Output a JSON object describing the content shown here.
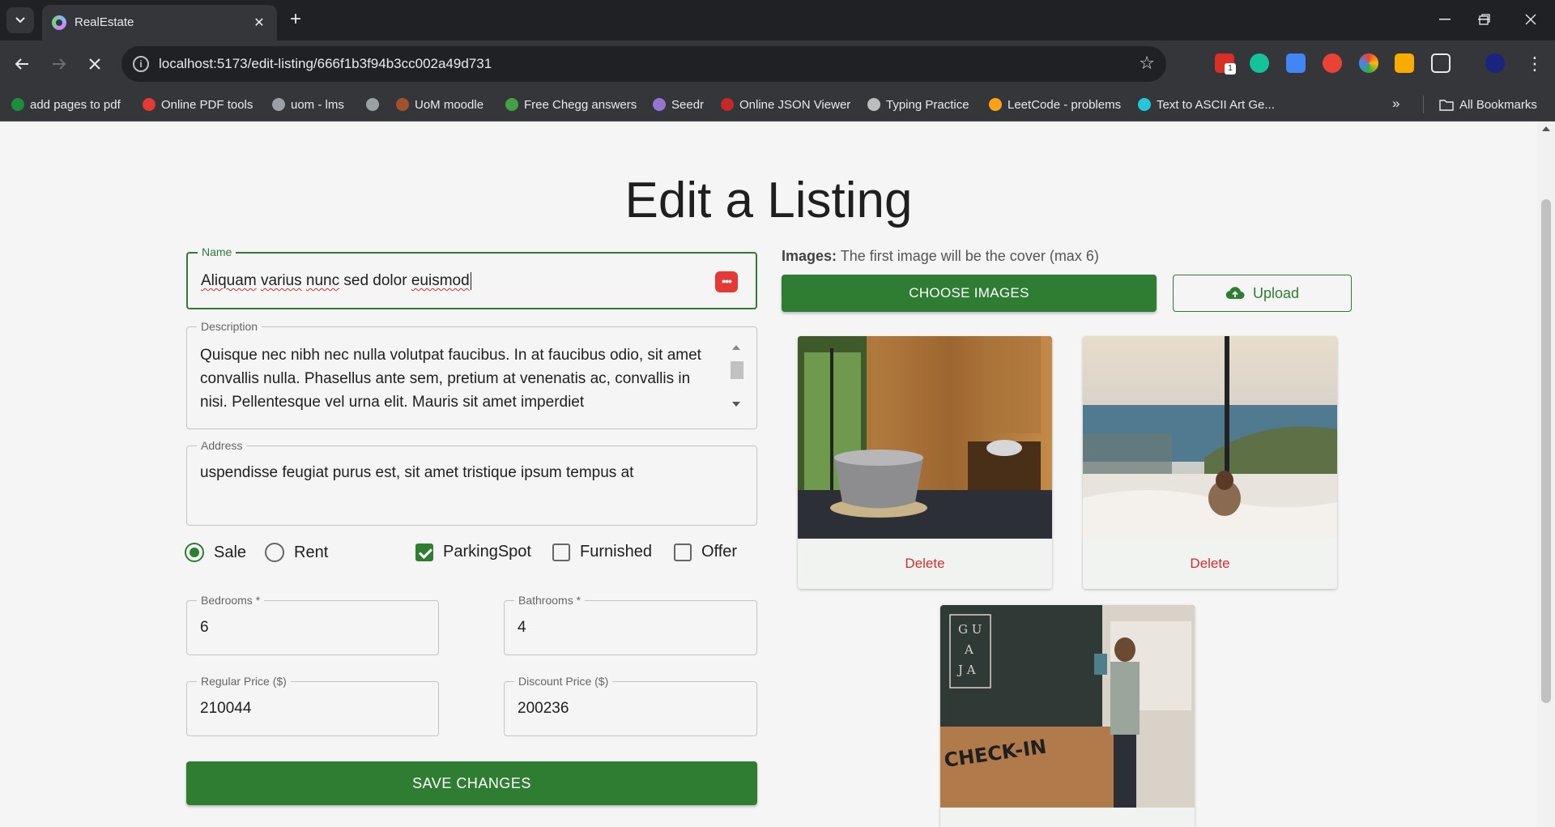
{
  "browser": {
    "tab_title": "RealEstate",
    "url": "localhost:5173/edit-listing/666f1b3f94b3cc002a49d731",
    "bookmarks": [
      {
        "label": "add pages to pdf",
        "color": "#1e8e3e"
      },
      {
        "label": "Online PDF tools",
        "color": "#e53935"
      },
      {
        "label": "uom - lms",
        "color": "#9aa0a6"
      },
      {
        "label": "",
        "color": "#9aa0a6"
      },
      {
        "label": "UoM moodle",
        "color": "#a0522d"
      },
      {
        "label": "Free Chegg answers",
        "color": "#43a047"
      },
      {
        "label": "Seedr",
        "color": "#9575cd"
      },
      {
        "label": "Online JSON Viewer",
        "color": "#c62828"
      },
      {
        "label": "Typing Practice",
        "color": "#bdbdbd"
      },
      {
        "label": "LeetCode - problems",
        "color": "#ffa116"
      },
      {
        "label": "Text to ASCII Art Ge...",
        "color": "#26c6da"
      }
    ],
    "all_bookmarks": "All Bookmarks",
    "extension_badge": "1"
  },
  "page": {
    "title": "Edit a Listing",
    "form": {
      "name": {
        "label": "Name",
        "value_parts": [
          "Aliquam",
          "varius",
          "nunc",
          "sed dolor",
          "euismod"
        ]
      },
      "description": {
        "label": "Description",
        "value": "Quisque nec nibh nec nulla volutpat faucibus. In at faucibus odio, sit amet convallis nulla. Phasellus ante sem, pretium at venenatis ac, convallis in nisi. Pellentesque vel urna elit. Mauris sit amet imperdiet"
      },
      "address": {
        "label": "Address",
        "value": "uspendisse feugiat purus est, sit amet tristique ipsum tempus at"
      },
      "type_options": [
        {
          "label": "Sale",
          "checked": true
        },
        {
          "label": "Rent",
          "checked": false
        }
      ],
      "feature_options": [
        {
          "label": "ParkingSpot",
          "checked": true
        },
        {
          "label": "Furnished",
          "checked": false
        },
        {
          "label": "Offer",
          "checked": false
        }
      ],
      "bedrooms": {
        "label": "Bedrooms *",
        "value": "6"
      },
      "bathrooms": {
        "label": "Bathrooms *",
        "value": "4"
      },
      "regular_price": {
        "label": "Regular Price ($)",
        "value": "210044"
      },
      "discount_price": {
        "label": "Discount Price ($)",
        "value": "200236"
      },
      "save_label": "SAVE CHANGES"
    },
    "images": {
      "note_bold": "Images:",
      "note_text": "The first image will be the cover (max 6)",
      "choose_label": "CHOOSE IMAGES",
      "upload_label": "Upload",
      "delete_label": "Delete",
      "cards": [
        "bathroom-photo",
        "ocean-bedroom-photo",
        "hotel-checkin-photo"
      ]
    }
  },
  "colors": {
    "accent": "#2e7d32",
    "danger": "#d32f2f"
  }
}
